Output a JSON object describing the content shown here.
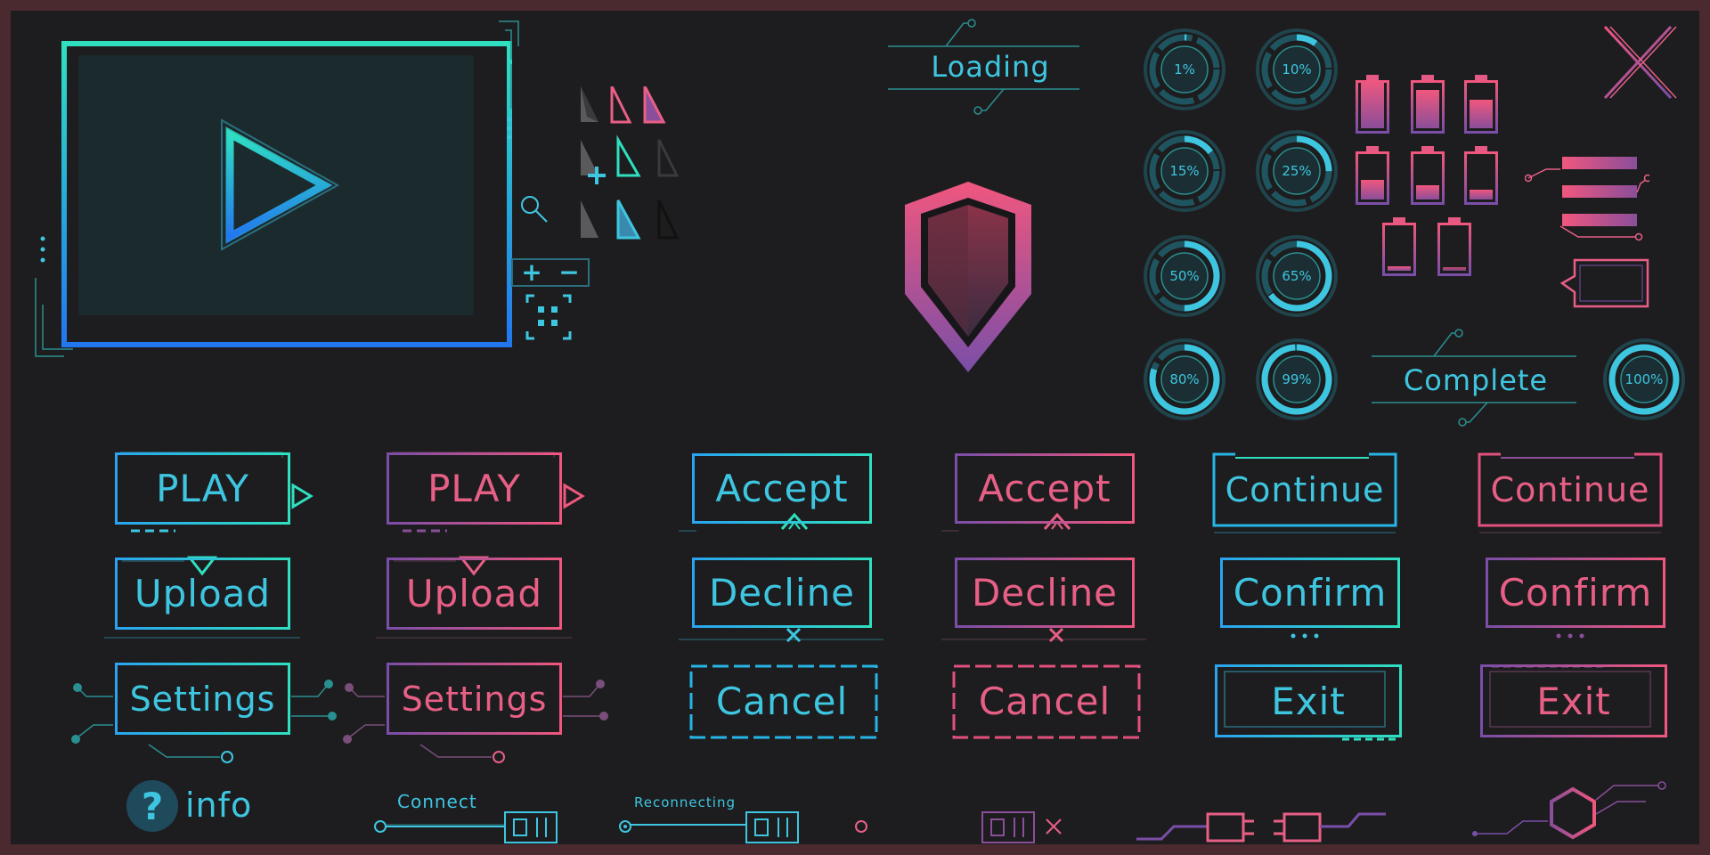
{
  "colors": {
    "cyan": "#3ec6e0",
    "teal": "#2fe0c0",
    "blue": "#2277f0",
    "pink": "#f0577e",
    "purple": "#7a4ea8",
    "bg": "#1d1d1f",
    "border": "#4a2a2e"
  },
  "loading": {
    "label": "Loading"
  },
  "complete": {
    "label": "Complete"
  },
  "progress_rings": [
    {
      "label": "1%",
      "value": 1
    },
    {
      "label": "10%",
      "value": 10
    },
    {
      "label": "15%",
      "value": 15
    },
    {
      "label": "25%",
      "value": 25
    },
    {
      "label": "50%",
      "value": 50
    },
    {
      "label": "65%",
      "value": 65
    },
    {
      "label": "80%",
      "value": 80
    },
    {
      "label": "99%",
      "value": 99
    },
    {
      "label": "100%",
      "value": 100
    }
  ],
  "batteries": [
    1.0,
    0.8,
    0.6,
    0.4,
    0.3,
    0.2,
    0.1,
    0.0
  ],
  "zoom": {
    "plus": "+",
    "minus": "−"
  },
  "buttons": {
    "play": "PLAY",
    "upload": "Upload",
    "settings": "Settings",
    "accept": "Accept",
    "decline": "Decline",
    "cancel": "Cancel",
    "continue": "Continue",
    "confirm": "Confirm",
    "exit": "Exit"
  },
  "info": {
    "icon": "?",
    "label": "info"
  },
  "connect": {
    "label": "Connect"
  },
  "reconnecting": {
    "label": "Reconnecting"
  },
  "icons": [
    "play-icon",
    "cursor-icon",
    "magnifier-icon",
    "shield-icon",
    "close-icon",
    "menu-icon",
    "speech-bubble-icon",
    "plug-icon",
    "hexagon-icon",
    "grid-icon"
  ]
}
